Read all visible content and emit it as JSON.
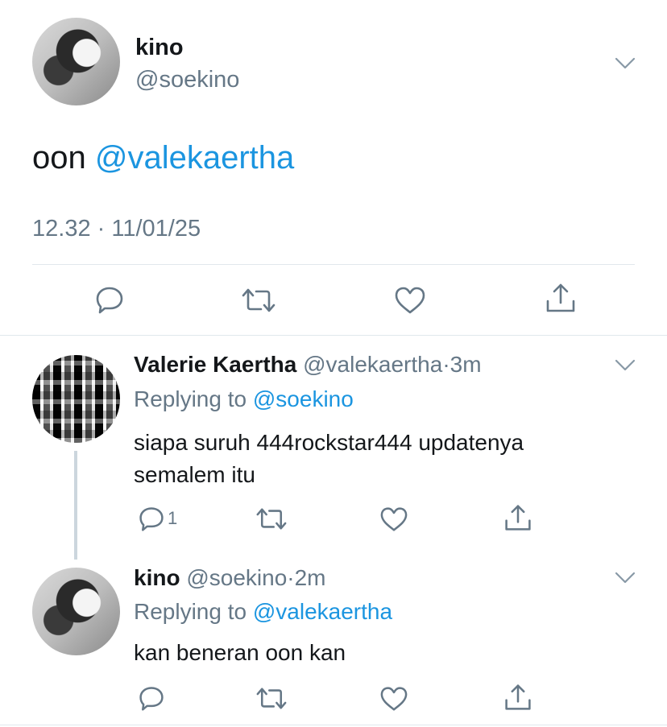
{
  "main_tweet": {
    "display_name": "kino",
    "handle": "@soekino",
    "text_plain": "oon",
    "text_mention": "@valekaertha",
    "timestamp": "12.32 · 11/01/25"
  },
  "replies": [
    {
      "display_name": "Valerie Kaertha",
      "handle": "@valekaertha",
      "time": "3m",
      "replying_prefix": "Replying to",
      "replying_to": "@soekino",
      "text_line1": "siapa suruh 444rockstar444 updatenya",
      "text_line2": "semalem itu",
      "reply_count": "1"
    },
    {
      "display_name": "kino",
      "handle": "@soekino",
      "time": "2m",
      "replying_prefix": "Replying to",
      "replying_to": "@valekaertha",
      "text_line1": "kan beneran oon kan",
      "reply_count": ""
    }
  ],
  "colors": {
    "accent": "#1da1f2",
    "icon_grey": "#657786",
    "divider": "#e1e8ed"
  },
  "icons": [
    "chevron-down-icon",
    "reply-icon",
    "retweet-icon",
    "like-icon",
    "share-icon"
  ]
}
